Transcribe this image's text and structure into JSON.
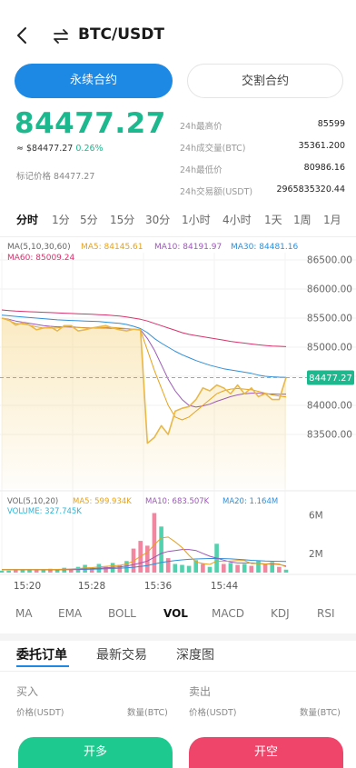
{
  "header": {
    "title": "BTC/USDT",
    "back_icon": "back-arrow-icon",
    "swap_icon": "swap-arrows-icon"
  },
  "contract_tabs": [
    {
      "label": "永续合约",
      "active": true
    },
    {
      "label": "交割合约",
      "active": false
    }
  ],
  "ticker": {
    "last_price": "84477.27",
    "approx_usd": "≈ $84477.27",
    "change_pct": "0.26%",
    "mark_price_label": "标记价格",
    "mark_price": "84477.27",
    "stats": [
      {
        "label": "24h最高价",
        "value": "85599"
      },
      {
        "label": "24h成交量(BTC)",
        "value": "35361.200"
      },
      {
        "label": "24h最低价",
        "value": "80986.16"
      },
      {
        "label": "24h交易额(USDT)",
        "value": "2965835320.44"
      }
    ]
  },
  "periods": [
    {
      "label": "分时",
      "active": true
    },
    {
      "label": "1分",
      "active": false
    },
    {
      "label": "5分",
      "active": false
    },
    {
      "label": "15分",
      "active": false
    },
    {
      "label": "30分",
      "active": false
    },
    {
      "label": "1小时",
      "active": false
    },
    {
      "label": "4小时",
      "active": false
    },
    {
      "label": "1天",
      "active": false
    },
    {
      "label": "1周",
      "active": false
    },
    {
      "label": "1月",
      "active": false
    }
  ],
  "ma_legend": {
    "params": "MA(5,10,30,60)",
    "ma5": "MA5: 84145.61",
    "ma10": "MA10: 84191.97",
    "ma30": "MA30: 84481.16",
    "ma60": "MA60: 85009.24"
  },
  "vol_legend": {
    "params": "VOL(5,10,20)",
    "ma5": "MA5: 599.934K",
    "ma10": "MA10: 683.507K",
    "ma20": "MA20: 1.164M",
    "volume": "VOLUME: 327.745K"
  },
  "colors": {
    "up": "#1eb88e",
    "down": "#f0456b",
    "accent": "#1e88e5",
    "ma5": "#e6a21a",
    "ma10": "#9b59b6",
    "ma30": "#2f8fd8",
    "ma60": "#d6336c",
    "price_line": "#e8b84a"
  },
  "chart_data": {
    "type": "line",
    "x_ticks": [
      "15:20",
      "15:28",
      "15:36",
      "15:44"
    ],
    "y_ticks": [
      "86500.00",
      "86000.00",
      "85500.00",
      "85000.00",
      "84500.00",
      "84000.00",
      "83500.00"
    ],
    "ylim": [
      83300,
      86600
    ],
    "current_price_label": "84477.27",
    "current_price": 84477.27,
    "price": [
      85500,
      85470,
      85380,
      85420,
      85380,
      85300,
      85330,
      85350,
      85280,
      85370,
      85370,
      85280,
      85300,
      85330,
      85350,
      85370,
      85330,
      85300,
      85280,
      85310,
      85300,
      83350,
      83450,
      83650,
      83500,
      83900,
      83950,
      83980,
      84100,
      84300,
      84250,
      84350,
      84300,
      84200,
      84350,
      84200,
      84300,
      84150,
      84200,
      84100,
      84100,
      84480
    ],
    "ma5": [
      85500,
      85460,
      85410,
      85400,
      85380,
      85350,
      85330,
      85330,
      85330,
      85350,
      85360,
      85340,
      85330,
      85330,
      85330,
      85340,
      85340,
      85330,
      85320,
      85310,
      85290,
      84950,
      84600,
      84300,
      84000,
      83800,
      83750,
      83800,
      83900,
      84000,
      84100,
      84200,
      84250,
      84280,
      84290,
      84280,
      84270,
      84240,
      84210,
      84180,
      84160,
      84145
    ],
    "ma10": [
      85500,
      85480,
      85450,
      85430,
      85410,
      85390,
      85370,
      85360,
      85350,
      85350,
      85345,
      85340,
      85335,
      85330,
      85330,
      85330,
      85325,
      85320,
      85315,
      85310,
      85300,
      85150,
      84950,
      84700,
      84450,
      84250,
      84100,
      84000,
      83970,
      83990,
      84020,
      84070,
      84110,
      84150,
      84180,
      84200,
      84210,
      84210,
      84200,
      84195,
      84192,
      84192
    ],
    "ma30": [
      85550,
      85540,
      85530,
      85520,
      85510,
      85500,
      85490,
      85480,
      85470,
      85465,
      85460,
      85455,
      85450,
      85445,
      85440,
      85430,
      85420,
      85410,
      85390,
      85360,
      85320,
      85250,
      85150,
      85070,
      85000,
      84930,
      84870,
      84820,
      84770,
      84730,
      84690,
      84660,
      84630,
      84610,
      84590,
      84570,
      84550,
      84520,
      84500,
      84490,
      84485,
      84481
    ],
    "ma60": [
      85640,
      85630,
      85620,
      85615,
      85610,
      85605,
      85600,
      85595,
      85590,
      85585,
      85580,
      85575,
      85570,
      85565,
      85560,
      85555,
      85545,
      85535,
      85520,
      85500,
      85480,
      85450,
      85410,
      85370,
      85330,
      85290,
      85250,
      85220,
      85200,
      85180,
      85160,
      85140,
      85120,
      85100,
      85085,
      85070,
      85055,
      85040,
      85030,
      85020,
      85015,
      85009
    ],
    "volume_y_ticks": [
      "6M",
      "2M"
    ],
    "volume": [
      0.2,
      0.2,
      0.25,
      0.3,
      0.3,
      0.25,
      0.3,
      0.4,
      0.35,
      0.5,
      0.4,
      0.6,
      0.8,
      0.5,
      0.9,
      0.6,
      1.0,
      0.8,
      1.2,
      2.5,
      3.3,
      2.8,
      6.2,
      4.8,
      1.5,
      0.9,
      0.8,
      0.7,
      1.3,
      0.9,
      0.6,
      3.0,
      0.9,
      1.0,
      0.8,
      0.9,
      0.7,
      1.2,
      0.9,
      1.1,
      0.6,
      0.3
    ],
    "volume_up": [
      true,
      true,
      false,
      true,
      true,
      false,
      true,
      false,
      true,
      true,
      false,
      true,
      true,
      false,
      true,
      false,
      true,
      false,
      true,
      false,
      false,
      false,
      false,
      true,
      false,
      true,
      true,
      true,
      true,
      false,
      true,
      true,
      false,
      true,
      false,
      true,
      false,
      true,
      false,
      true,
      false,
      true
    ],
    "vol_ma5": [
      0.3,
      0.3,
      0.3,
      0.3,
      0.3,
      0.3,
      0.3,
      0.32,
      0.33,
      0.36,
      0.38,
      0.42,
      0.48,
      0.52,
      0.6,
      0.65,
      0.7,
      0.76,
      0.9,
      1.2,
      1.7,
      2.1,
      2.9,
      3.6,
      3.7,
      3.2,
      2.6,
      1.8,
      1.1,
      0.95,
      0.85,
      1.2,
      1.15,
      1.2,
      1.25,
      1.25,
      0.95,
      0.95,
      0.9,
      0.95,
      0.9,
      0.6
    ],
    "vol_ma10": [
      0.3,
      0.3,
      0.3,
      0.3,
      0.3,
      0.3,
      0.3,
      0.3,
      0.31,
      0.32,
      0.34,
      0.36,
      0.39,
      0.42,
      0.46,
      0.5,
      0.55,
      0.6,
      0.68,
      0.82,
      1.0,
      1.2,
      1.6,
      2.0,
      2.2,
      2.3,
      2.4,
      2.4,
      2.3,
      2.0,
      1.7,
      1.5,
      1.3,
      1.1,
      1.0,
      1.0,
      1.0,
      0.95,
      0.9,
      0.9,
      0.85,
      0.68
    ],
    "vol_ma20": [
      0.3,
      0.3,
      0.3,
      0.3,
      0.3,
      0.3,
      0.3,
      0.3,
      0.3,
      0.3,
      0.31,
      0.32,
      0.33,
      0.35,
      0.37,
      0.4,
      0.43,
      0.46,
      0.5,
      0.56,
      0.64,
      0.74,
      0.9,
      1.05,
      1.15,
      1.25,
      1.32,
      1.38,
      1.42,
      1.45,
      1.47,
      1.48,
      1.46,
      1.43,
      1.38,
      1.33,
      1.28,
      1.24,
      1.2,
      1.18,
      1.17,
      1.16
    ],
    "vol_ylim": [
      0,
      7
    ]
  },
  "indicators": [
    {
      "label": "MA",
      "active": false
    },
    {
      "label": "EMA",
      "active": false
    },
    {
      "label": "BOLL",
      "active": false
    },
    {
      "label": "VOL",
      "active": true
    },
    {
      "label": "MACD",
      "active": false
    },
    {
      "label": "KDJ",
      "active": false
    },
    {
      "label": "RSI",
      "active": false
    }
  ],
  "order_tabs": [
    {
      "label": "委托订单",
      "active": true
    },
    {
      "label": "最新交易",
      "active": false
    },
    {
      "label": "深度图",
      "active": false
    }
  ],
  "order_book": {
    "buy_label": "买入",
    "sell_label": "卖出",
    "price_col": "价格(USDT)",
    "qty_col": "数量(BTC)"
  },
  "actions": {
    "long_label": "开多",
    "short_label": "开空"
  }
}
